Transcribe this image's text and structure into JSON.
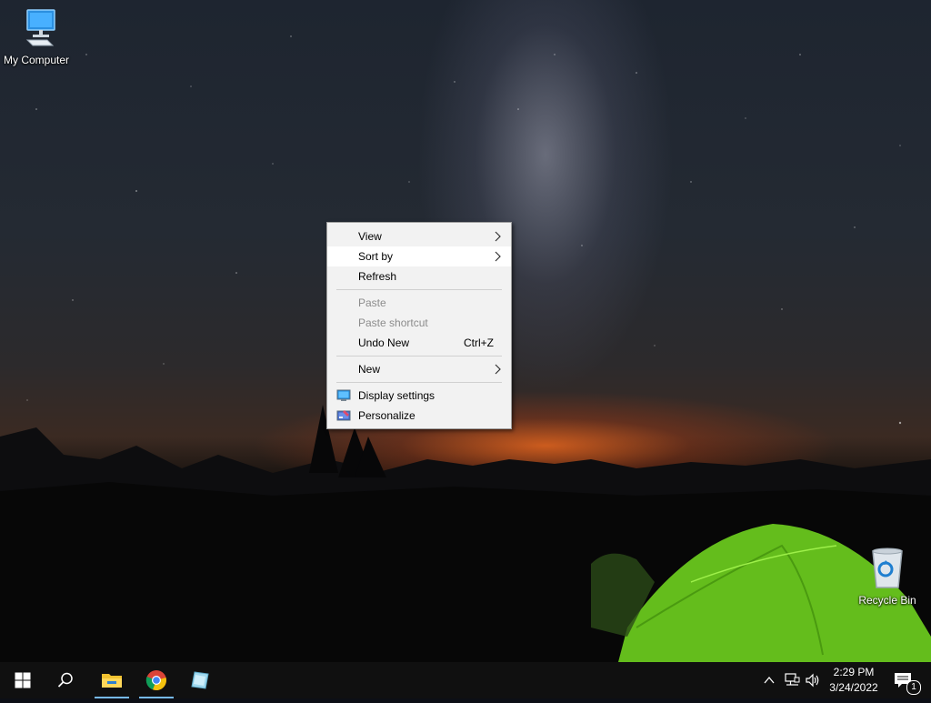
{
  "desktop": {
    "icons": [
      {
        "label": "My Computer",
        "icon": "computer-icon"
      },
      {
        "label": "Recycle Bin",
        "icon": "recycle-bin-icon"
      }
    ]
  },
  "context_menu": {
    "items": [
      {
        "label": "View",
        "submenu": true,
        "enabled": true
      },
      {
        "label": "Sort by",
        "submenu": true,
        "enabled": true,
        "highlighted": true
      },
      {
        "label": "Refresh",
        "enabled": true
      },
      {
        "label": "Paste",
        "enabled": false
      },
      {
        "label": "Paste shortcut",
        "enabled": false
      },
      {
        "label": "Undo New",
        "shortcut": "Ctrl+Z",
        "enabled": true
      },
      {
        "label": "New",
        "submenu": true,
        "enabled": true
      },
      {
        "label": "Display settings",
        "icon": "display-settings-icon",
        "enabled": true
      },
      {
        "label": "Personalize",
        "icon": "personalize-icon",
        "enabled": true
      }
    ]
  },
  "taskbar": {
    "pinned": [
      "start-icon",
      "search-icon",
      "file-explorer-icon",
      "chrome-icon",
      "app-icon"
    ],
    "clock": {
      "time": "2:29 PM",
      "date": "3/24/2022"
    },
    "notification_count": "1",
    "accent_color": "#76b9ed"
  }
}
